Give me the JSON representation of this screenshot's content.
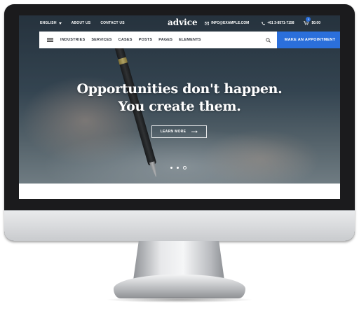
{
  "topbar": {
    "language": "ENGLISH",
    "links": [
      "ABOUT US",
      "CONTACT US"
    ],
    "logo": "advice",
    "email": "INFO@EXAMPLE.COM",
    "phone": "+61 3-8571-7158",
    "cart_count": "0",
    "cart_total": "$0.00"
  },
  "nav": {
    "items": [
      "INDUSTRIES",
      "SERVICES",
      "CASES",
      "POSTS",
      "PAGES",
      "ELEMENTS"
    ],
    "cta": "MAKE AN APPOINTMENT"
  },
  "hero": {
    "headline_line1": "Opportunities don't happen.",
    "headline_line2": "You create them.",
    "button": "LEARN MORE",
    "slides_total": 3,
    "active_slide": 3
  },
  "colors": {
    "accent": "#2b6fdb",
    "bezel": "#1b1b1d"
  },
  "icons": [
    "chevron-down-icon",
    "envelope-icon",
    "phone-icon",
    "cart-icon",
    "hamburger-menu-icon",
    "search-icon",
    "arrow-right-icon"
  ]
}
